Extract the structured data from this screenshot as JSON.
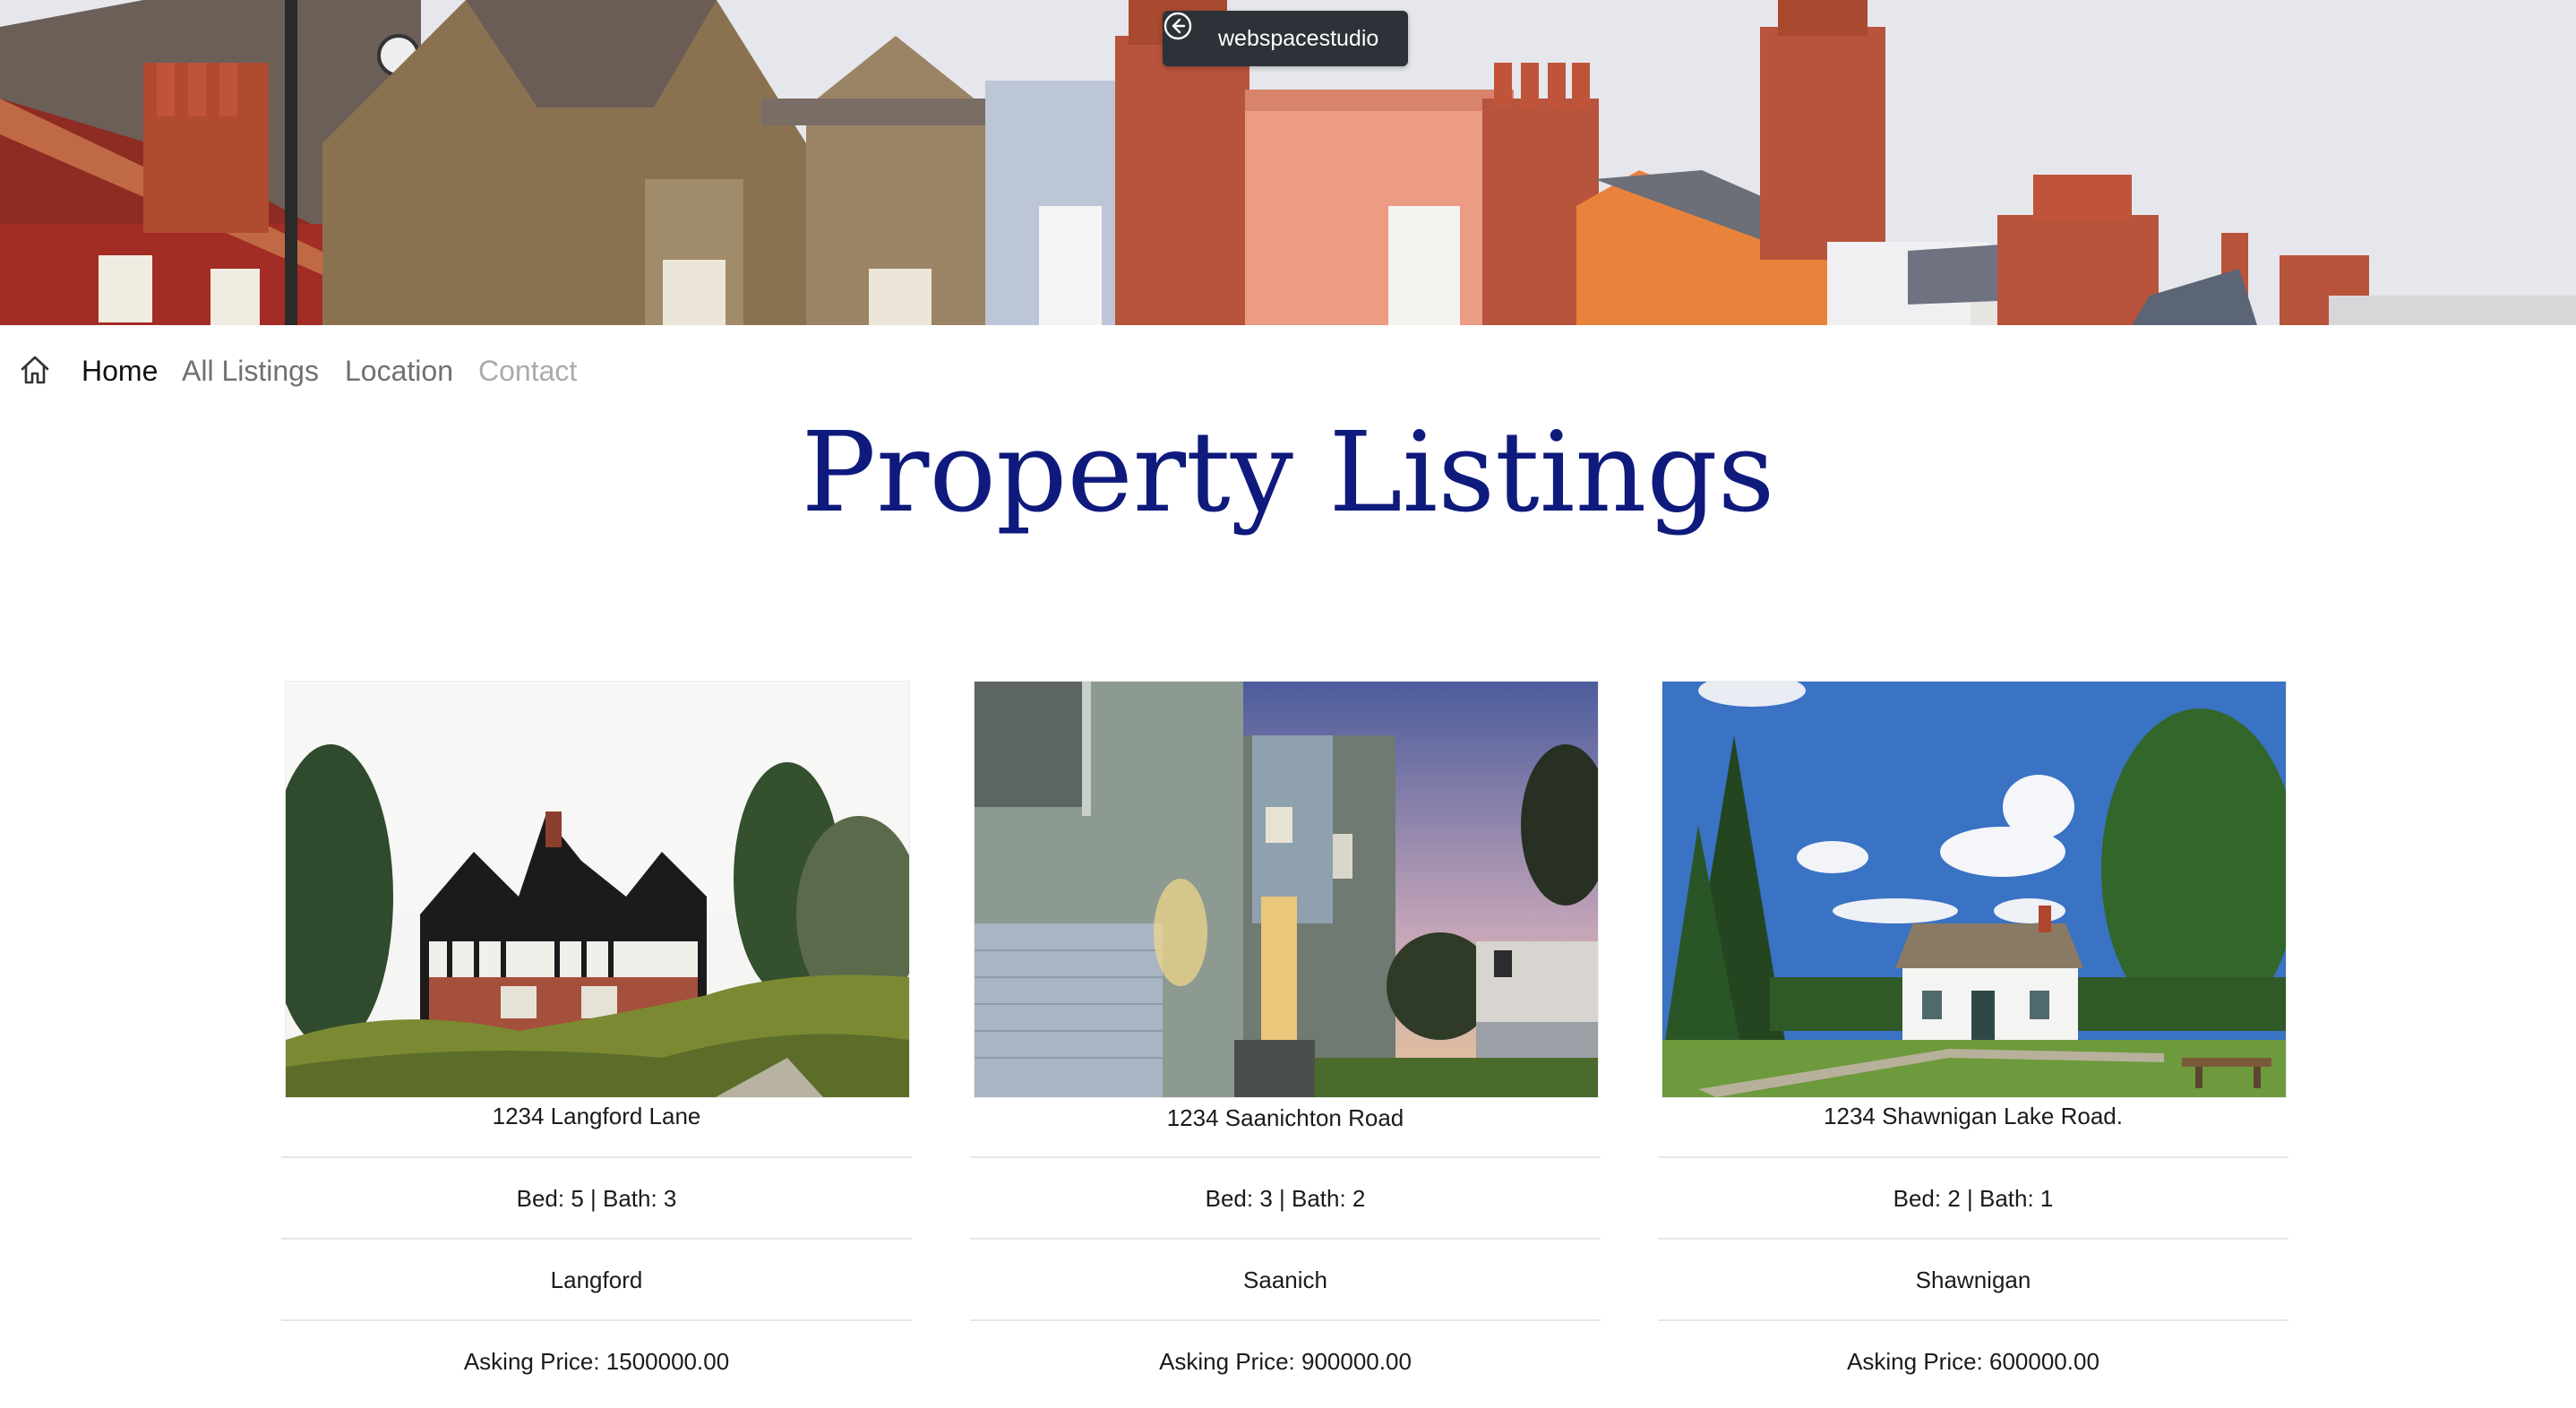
{
  "banner": {
    "badge_label": "webspacestudio",
    "badge_icon": "arrow-left-circle-icon"
  },
  "nav": {
    "home_icon": "home-icon",
    "items": [
      {
        "label": "Home",
        "state": "active"
      },
      {
        "label": "All Listings",
        "state": "normal"
      },
      {
        "label": "Location",
        "state": "normal"
      },
      {
        "label": "Contact",
        "state": "muted"
      }
    ]
  },
  "page": {
    "title": "Property Listings",
    "title_color": "#0f1a7d"
  },
  "listings": [
    {
      "address": "1234 Langford Lane",
      "beds_baths": "Bed: 5 | Bath: 3",
      "city": "Langford",
      "price": "Asking Price: 1500000.00",
      "photo": "tudor-house-photo"
    },
    {
      "address": "1234 Saanichton Road",
      "beds_baths": "Bed: 3 | Bath: 2",
      "city": "Saanich",
      "price": "Asking Price: 900000.00",
      "photo": "modern-house-photo"
    },
    {
      "address": "1234 Shawnigan Lake Road.",
      "beds_baths": "Bed: 2 | Bath: 1",
      "city": "Shawnigan",
      "price": "Asking Price: 600000.00",
      "photo": "white-cottage-photo"
    }
  ]
}
